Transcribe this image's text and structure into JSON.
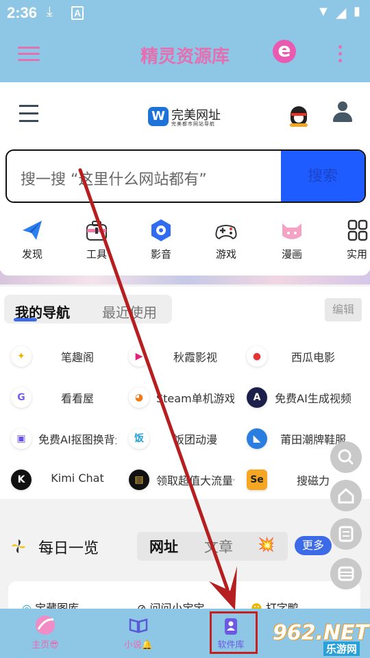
{
  "status_bar": {
    "time": "2:36"
  },
  "app_bar": {
    "title": "精灵资源库"
  },
  "site_header": {
    "brand_name": "完美网址",
    "brand_tagline": "完美都市网站导航"
  },
  "search": {
    "placeholder": "搜一搜 “这里什么网站都有”",
    "button": "搜索"
  },
  "categories": [
    "发现",
    "工具",
    "影音",
    "游戏",
    "漫画",
    "实用"
  ],
  "my_nav": {
    "tab_active": "我的导航",
    "tab_other": "最近使用",
    "edit": "编辑",
    "sites": [
      [
        "笔趣阁",
        "秋霞影视",
        "西瓜电影"
      ],
      [
        "看看屋",
        "Steam单机游戏",
        "免费AI生成视频"
      ],
      [
        "免费AI抠图换背景",
        "饭团动漫",
        "莆田潮牌鞋服"
      ],
      [
        "Kimi Chat",
        "领取超值大流量卡",
        "搜磁力"
      ]
    ]
  },
  "daily": {
    "title": "每日一览",
    "tab_active": "网址",
    "tab_other": "文章",
    "more": "更多",
    "sites": [
      "宝藏图库",
      "问问小宝宝",
      "打字鸭"
    ]
  },
  "bottom_nav": [
    {
      "label": "主页😎"
    },
    {
      "label": "小说🔔"
    },
    {
      "label": "软件库"
    }
  ],
  "watermark": {
    "main": "962.NET",
    "sub": "乐游网"
  },
  "colors": {
    "app_bar": "#8ec6e6",
    "accent_pink": "#e46fb1",
    "search_button": "#1e5cff",
    "highlight": "#c32020"
  }
}
